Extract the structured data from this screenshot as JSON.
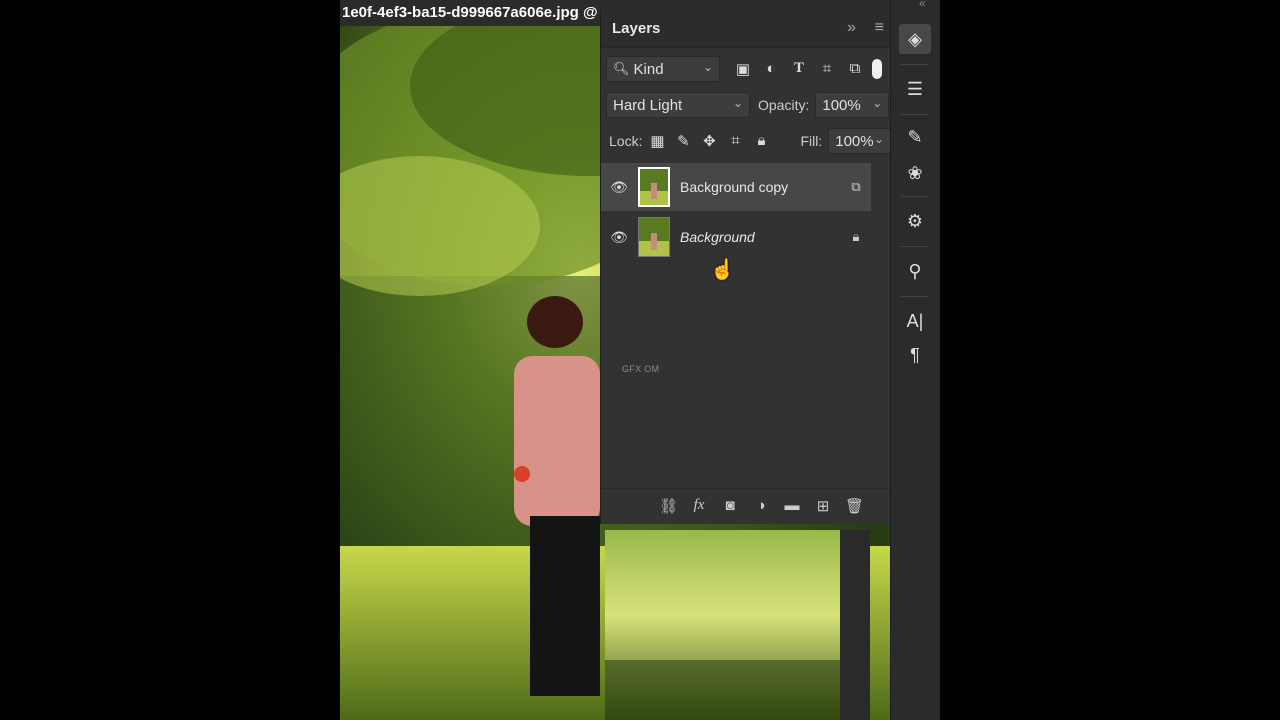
{
  "document": {
    "tab_title": "1e0f-4ef3-ba15-d999667a606e.jpg @"
  },
  "layers_panel": {
    "title": "Layers",
    "collapse_glyph": "»",
    "menu_glyph": "≡",
    "filter": {
      "kind_label": "Kind",
      "icons": [
        "image-filter-icon",
        "adjustment-filter-icon",
        "type-filter-icon",
        "shape-filter-icon",
        "smart-object-filter-icon"
      ]
    },
    "blend_mode": "Hard Light",
    "opacity_label": "Opacity:",
    "opacity_value": "100%",
    "lock_label": "Lock:",
    "fill_label": "Fill:",
    "fill_value": "100%",
    "layers": [
      {
        "name": "Background copy",
        "selected": true,
        "italic": false,
        "badge": "smart-object-icon"
      },
      {
        "name": "Background",
        "selected": false,
        "italic": true,
        "badge": "lock-icon"
      }
    ],
    "watermark": "GFX OM",
    "footer_icons": [
      "link-layers-icon",
      "fx-icon",
      "layer-mask-icon",
      "adjustment-layer-icon",
      "group-folder-icon",
      "new-layer-icon",
      "trash-icon"
    ]
  },
  "right_strip": {
    "tools": [
      "layers-icon",
      "properties-icon",
      "brush-settings-icon",
      "color-icon",
      "adjustments-icon",
      "clone-source-icon",
      "character-icon",
      "paragraph-icon"
    ]
  },
  "colors": {
    "panel_bg": "#323232",
    "selected_row": "#474747",
    "strip_bg": "#2b2b2b"
  }
}
